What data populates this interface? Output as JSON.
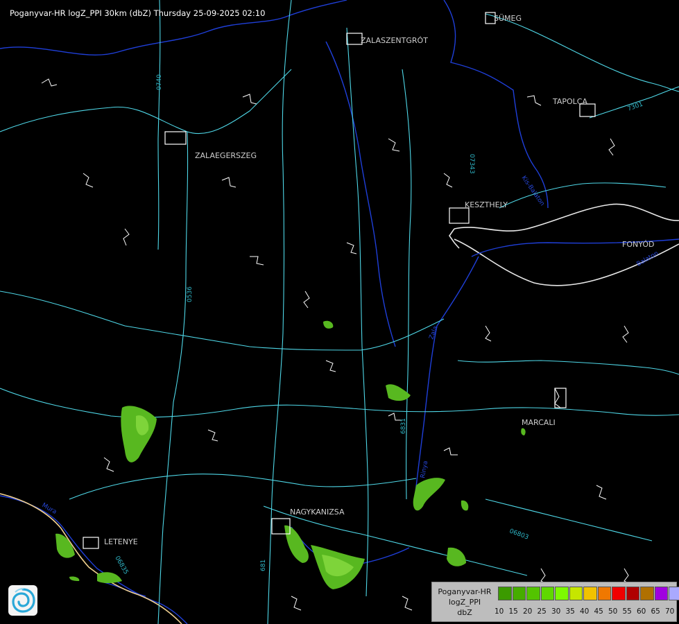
{
  "header": {
    "title": "Poganyvar-HR logZ_PPI 30km (dbZ) Thursday 25-09-2025 02:10"
  },
  "cities": [
    {
      "name": "SÜMEG"
    },
    {
      "name": "ZALASZENTGRÓT"
    },
    {
      "name": "TAPOLCA"
    },
    {
      "name": "ZALAEGERSZEG"
    },
    {
      "name": "KESZTHELY"
    },
    {
      "name": "FONYÓD"
    },
    {
      "name": "MARCALI"
    },
    {
      "name": "NAGYKANIZSA"
    },
    {
      "name": "LETENYE"
    }
  ],
  "road_labels": [
    "0740",
    "07343",
    "0536",
    "6831",
    "06803",
    "06835",
    "681",
    "7301"
  ],
  "river_labels": [
    "Zala",
    "Rinya",
    "Mura",
    "Balaton",
    "Kis-Balaton"
  ],
  "legend": {
    "line1": "Poganyvar-HR",
    "line2": "logZ_PPI",
    "line3": "dbZ",
    "scale": [
      {
        "value": "10",
        "color": "#3b9a00"
      },
      {
        "value": "15",
        "color": "#46ad00"
      },
      {
        "value": "20",
        "color": "#53c400"
      },
      {
        "value": "25",
        "color": "#5fd900"
      },
      {
        "value": "30",
        "color": "#7dfb00"
      },
      {
        "value": "35",
        "color": "#c6e600"
      },
      {
        "value": "40",
        "color": "#f2c200"
      },
      {
        "value": "45",
        "color": "#f07800"
      },
      {
        "value": "50",
        "color": "#f00000"
      },
      {
        "value": "55",
        "color": "#b00000"
      },
      {
        "value": "60",
        "color": "#b07000"
      },
      {
        "value": "65",
        "color": "#a000e0"
      },
      {
        "value": "70",
        "color": "#a9a9ff"
      }
    ]
  },
  "colors": {
    "background": "#000000",
    "roads": "#4fd8e8",
    "rivers": "#1f3fd9",
    "boundaries": "#ffffff",
    "border": "#f0d090",
    "echo_weak": "#58b820",
    "echo_strong": "#7ed43a"
  }
}
